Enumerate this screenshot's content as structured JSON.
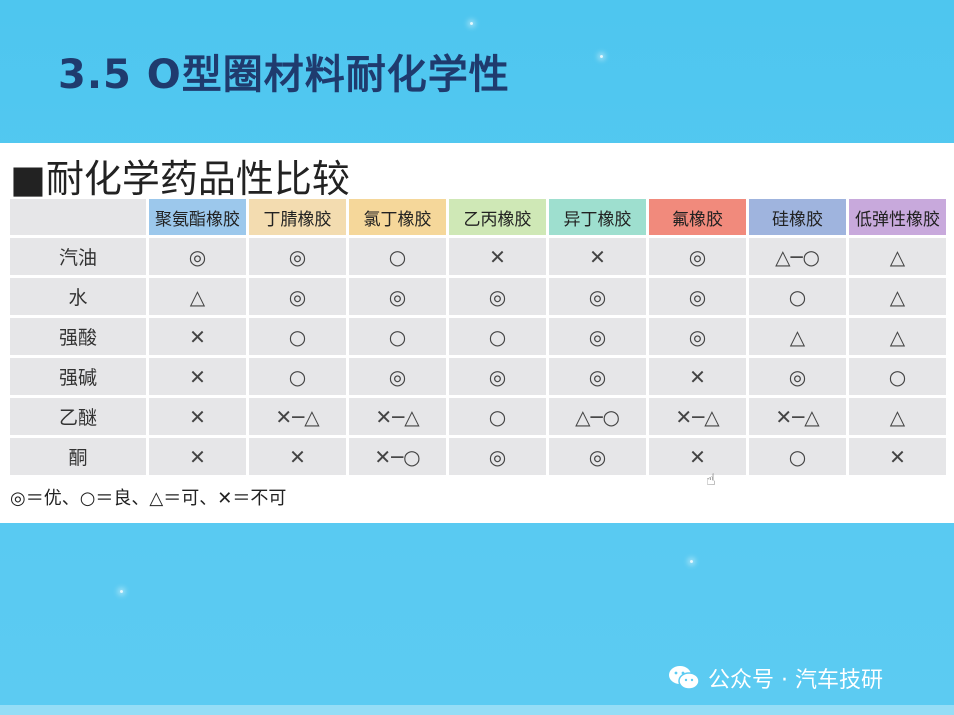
{
  "slide": {
    "title": "3.5 O型圈材料耐化学性",
    "subtitle": "■耐化学药品性比较"
  },
  "table": {
    "headers": [
      {
        "label": "",
        "color": "#e6e6e8"
      },
      {
        "label": "聚氨酯橡胶",
        "color": "#9cc8ec"
      },
      {
        "label": "丁腈橡胶",
        "color": "#f3dcb0"
      },
      {
        "label": "氯丁橡胶",
        "color": "#f5d79a"
      },
      {
        "label": "乙丙橡胶",
        "color": "#cfe8b6"
      },
      {
        "label": "异丁橡胶",
        "color": "#9edfcf"
      },
      {
        "label": "氟橡胶",
        "color": "#f18a7c"
      },
      {
        "label": "硅橡胶",
        "color": "#9fb4de"
      },
      {
        "label": "低弹性橡胶",
        "color": "#c8a9dc"
      }
    ],
    "rows": [
      {
        "label": "汽油",
        "values": [
          "◎",
          "◎",
          "○",
          "✕",
          "✕",
          "◎",
          "△─○",
          "△"
        ]
      },
      {
        "label": "水",
        "values": [
          "△",
          "◎",
          "◎",
          "◎",
          "◎",
          "◎",
          "○",
          "△"
        ]
      },
      {
        "label": "强酸",
        "values": [
          "✕",
          "○",
          "○",
          "○",
          "◎",
          "◎",
          "△",
          "△"
        ]
      },
      {
        "label": "强碱",
        "values": [
          "✕",
          "○",
          "◎",
          "◎",
          "◎",
          "✕",
          "◎",
          "○"
        ]
      },
      {
        "label": "乙醚",
        "values": [
          "✕",
          "✕─△",
          "✕─△",
          "○",
          "△─○",
          "✕─△",
          "✕─△",
          "△"
        ]
      },
      {
        "label": "酮",
        "values": [
          "✕",
          "✕",
          "✕─○",
          "◎",
          "◎",
          "✕",
          "○",
          "✕"
        ]
      }
    ]
  },
  "legend": "◎＝优、○＝良、△＝可、✕＝不可",
  "watermark": {
    "text": "公众号 · 汽车技研",
    "icon": "wechat-icon"
  },
  "cursor_icon": "hand-cursor-icon"
}
